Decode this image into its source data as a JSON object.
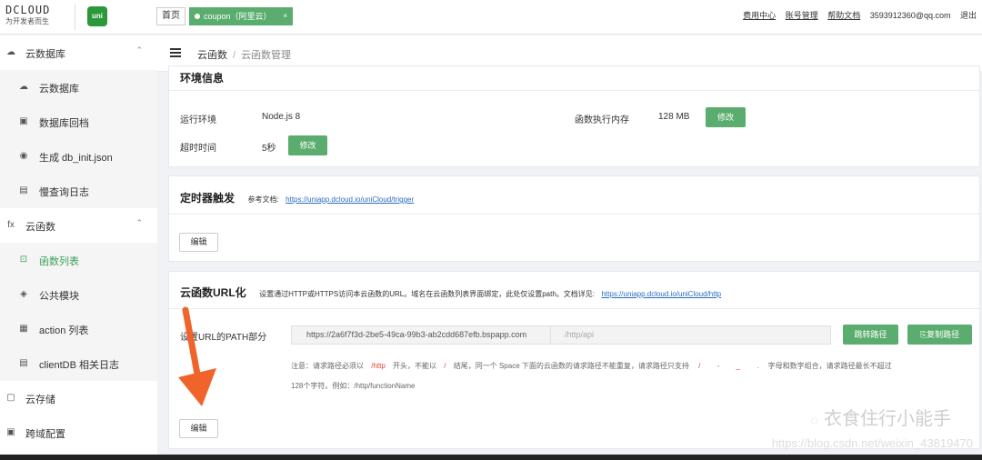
{
  "header": {
    "logo_text": "DCLOUD",
    "logo_sub": "为开发者而生",
    "uni_badge": "uni",
    "home_label": "首页",
    "space_label": "coupon（阿里云）",
    "space_close": "×",
    "links": [
      "费用中心",
      "账号管理",
      "帮助文档"
    ],
    "user": "3593912360@qq.com",
    "logout": "退出"
  },
  "sidebar": {
    "items": [
      {
        "label": "云数据库",
        "type": "group",
        "icon": "cloud-db-icon",
        "chevron": "⌃"
      },
      {
        "label": "云数据库",
        "type": "sub",
        "icon": "cloud-db-icon"
      },
      {
        "label": "数据库回档",
        "type": "sub",
        "icon": "restore-icon"
      },
      {
        "label": "生成 db_init.json",
        "type": "sub",
        "icon": "generate-icon"
      },
      {
        "label": "慢查询日志",
        "type": "sub",
        "icon": "log-icon"
      },
      {
        "label": "云函数",
        "type": "group",
        "icon": "fx-icon",
        "chevron": "⌃"
      },
      {
        "label": "函数列表",
        "type": "sub",
        "icon": "function-list-icon",
        "active": true
      },
      {
        "label": "公共模块",
        "type": "sub",
        "icon": "module-icon"
      },
      {
        "label": "action 列表",
        "type": "sub",
        "icon": "action-icon"
      },
      {
        "label": "clientDB 相关日志",
        "type": "sub",
        "icon": "log-icon"
      },
      {
        "label": "云存储",
        "type": "group",
        "icon": "storage-icon"
      },
      {
        "label": "跨域配置",
        "type": "group",
        "icon": "cors-icon"
      }
    ]
  },
  "breadcrumb": {
    "root": "云函数",
    "sep": "/",
    "current": "云函数管理"
  },
  "env": {
    "title": "环境信息",
    "runtime_label": "运行环境",
    "runtime_value": "Node.js 8",
    "memory_label": "函数执行内存",
    "memory_value": "128 MB",
    "modify_label": "修改",
    "timeout_label": "超时时间",
    "timeout_value": "5秒"
  },
  "timer": {
    "title": "定时器触发",
    "doc_prefix": "参考文档:",
    "doc_link": "https://uniapp.dcloud.io/uniCloud/trigger",
    "edit_label": "编辑"
  },
  "url": {
    "title": "云函数URL化",
    "desc": "设置通过HTTP或HTTPS访问本云函数的URL。域名在云函数列表界面绑定，此处仅设置path。文档详见:",
    "doc_link": "https://uniapp.dcloud.io/uniCloud/http",
    "path_label": "设置URL的PATH部分",
    "domain_value": "https://2a6f7f3d-2be5-49ca-99b3-ab2cdd687efb.bspapp.com",
    "path_placeholder": "/http/api",
    "jump_label": "跳转路径",
    "copy_label": "复制路径",
    "note_prefix": "注意：请求路径必须以",
    "note_http": "/http",
    "note_mid1": "开头，不能以",
    "note_slash": "/",
    "note_mid2": "结尾，同一个 Space 下面的云函数的请求路径不能重复，请求路径只支持",
    "note_chars1": "/",
    "note_chars2": "-",
    "note_chars3": "_",
    "note_chars4": ".",
    "note_mid3": "字母和数字组合，请求路径最长不超过",
    "note_line2": "128个字符。例如：/http/functionName",
    "edit_label": "编辑"
  },
  "watermark": {
    "text": "衣食住行小能手",
    "url": "https://blog.csdn.net/weixin_43819470"
  },
  "colors": {
    "accent": "#5aad6e",
    "link": "#2a6cc0",
    "red": "#e0472e"
  }
}
